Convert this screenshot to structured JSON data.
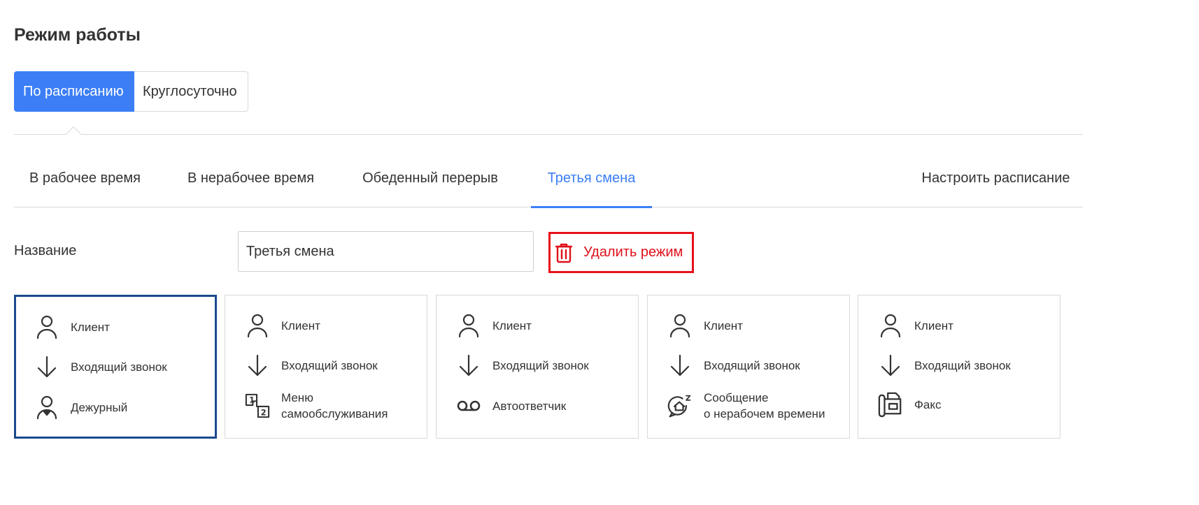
{
  "page": {
    "title": "Режим работы"
  },
  "mode_switch": {
    "scheduled": "По расписанию",
    "round_the_clock": "Круглосуточно"
  },
  "tabs": [
    {
      "label": "В рабочее время"
    },
    {
      "label": "В нерабочее время"
    },
    {
      "label": "Обеденный перерыв"
    },
    {
      "label": "Третья смена",
      "active": true
    }
  ],
  "configure_schedule": "Настроить расписание",
  "name_field": {
    "label": "Название",
    "value": "Третья смена"
  },
  "delete_button": {
    "label": "Удалить режим",
    "color": "#e0101a"
  },
  "colors": {
    "accent": "#3b7ef6",
    "selected_border": "#1a4a8e"
  },
  "cards": [
    {
      "rows": [
        {
          "icon": "person-icon",
          "label": "Клиент"
        },
        {
          "icon": "arrow-down-icon",
          "label": "Входящий звонок"
        },
        {
          "icon": "duty-person-icon",
          "label": "Дежурный"
        }
      ]
    },
    {
      "rows": [
        {
          "icon": "person-icon",
          "label": "Клиент"
        },
        {
          "icon": "arrow-down-icon",
          "label": "Входящий звонок"
        },
        {
          "icon": "ivr-menu-icon",
          "label": "Меню\nсамообслуживания"
        }
      ]
    },
    {
      "rows": [
        {
          "icon": "person-icon",
          "label": "Клиент"
        },
        {
          "icon": "arrow-down-icon",
          "label": "Входящий звонок"
        },
        {
          "icon": "voicemail-icon",
          "label": "Автоответчик"
        }
      ]
    },
    {
      "rows": [
        {
          "icon": "person-icon",
          "label": "Клиент"
        },
        {
          "icon": "arrow-down-icon",
          "label": "Входящий звонок"
        },
        {
          "icon": "after-hours-message-icon",
          "label": "Сообщение\nо нерабочем времени"
        }
      ]
    },
    {
      "rows": [
        {
          "icon": "person-icon",
          "label": "Клиент"
        },
        {
          "icon": "arrow-down-icon",
          "label": "Входящий звонок"
        },
        {
          "icon": "fax-icon",
          "label": "Факс"
        }
      ]
    }
  ]
}
